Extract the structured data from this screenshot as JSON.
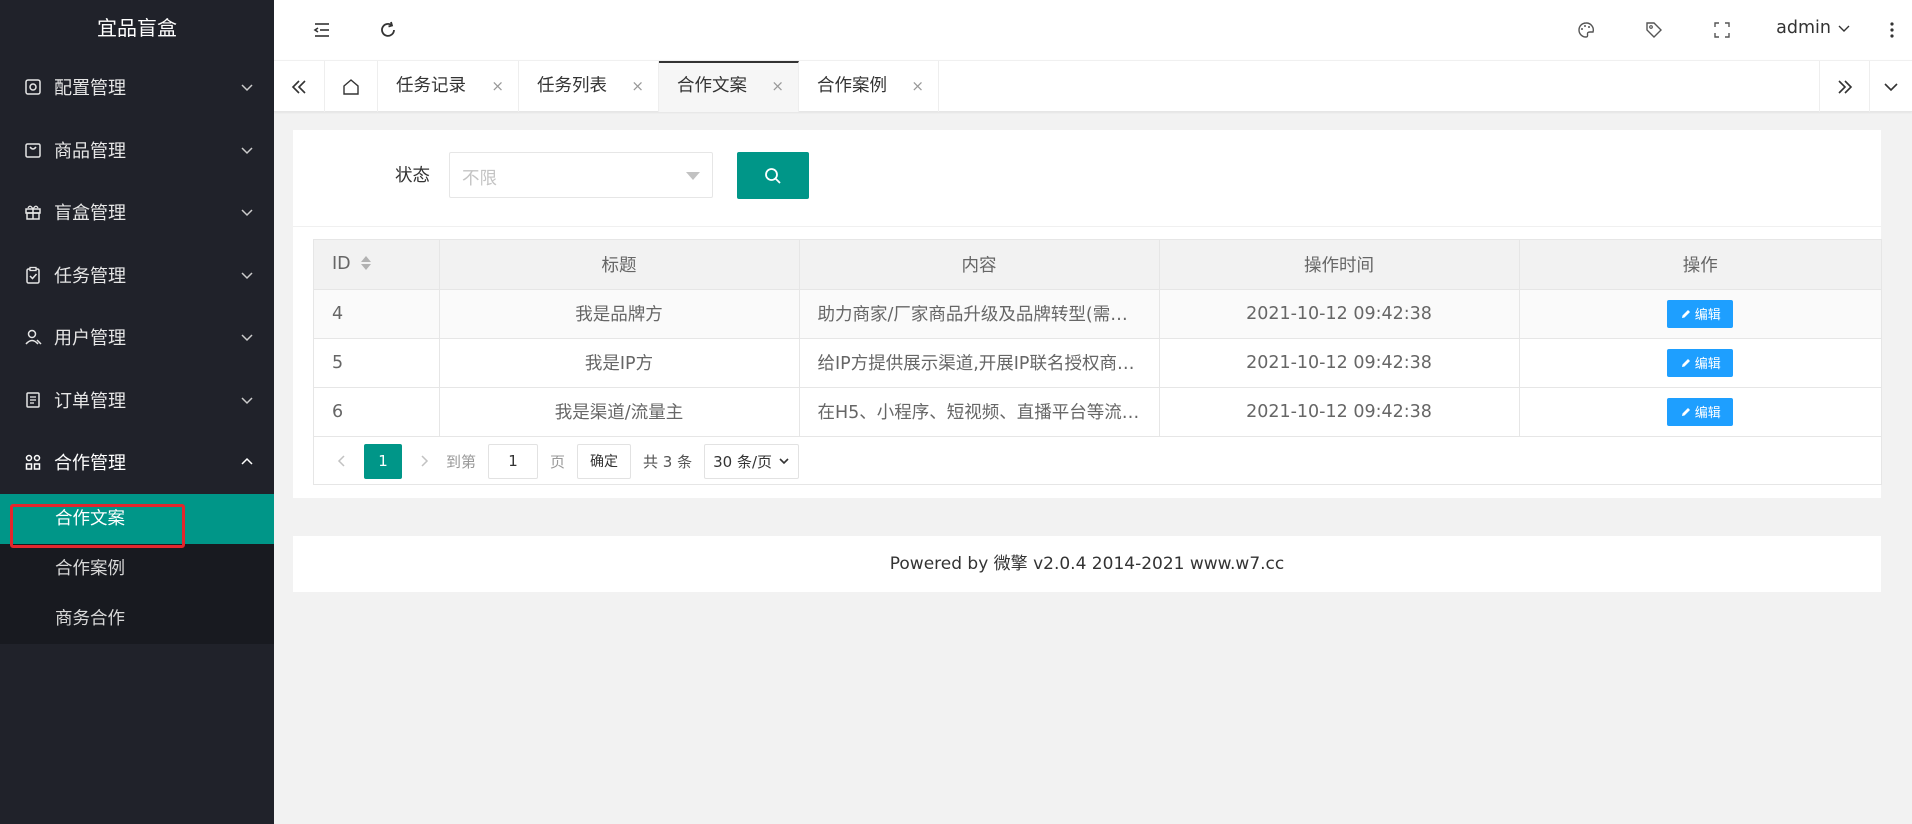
{
  "app": {
    "title": "宜品盲盒"
  },
  "sidebar": {
    "items": [
      {
        "label": "配置管理",
        "icon": "settings-icon"
      },
      {
        "label": "商品管理",
        "icon": "shopping-bag-icon"
      },
      {
        "label": "盲盒管理",
        "icon": "gift-icon"
      },
      {
        "label": "任务管理",
        "icon": "clipboard-check-icon"
      },
      {
        "label": "用户管理",
        "icon": "user-icon"
      },
      {
        "label": "订单管理",
        "icon": "document-icon"
      },
      {
        "label": "合作管理",
        "icon": "cooperation-icon"
      }
    ],
    "sub_items": [
      {
        "label": "合作文案",
        "active": true
      },
      {
        "label": "合作案例",
        "active": false
      },
      {
        "label": "商务合作",
        "active": false
      }
    ]
  },
  "header": {
    "user": "admin",
    "icons": [
      "menu-fold-icon",
      "refresh-icon",
      "theme-icon",
      "tag-icon",
      "fullscreen-icon",
      "more-vertical-icon"
    ]
  },
  "tabs": [
    {
      "label": "任务记录",
      "close": "×"
    },
    {
      "label": "任务列表",
      "close": "×"
    },
    {
      "label": "合作文案",
      "close": "×",
      "active": true
    },
    {
      "label": "合作案例",
      "close": "×"
    }
  ],
  "filter": {
    "status_label": "状态",
    "status_placeholder": "不限"
  },
  "table": {
    "headers": [
      "ID",
      "标题",
      "内容",
      "操作时间",
      "操作"
    ],
    "rows": [
      {
        "id": "4",
        "title": "我是品牌方",
        "content": "助力商家/厂家商品升级及品牌转型(需…",
        "time": "2021-10-12 09:42:38",
        "action": "编辑"
      },
      {
        "id": "5",
        "title": "我是IP方",
        "content": "给IP方提供展示渠道,开展IP联名授权商…",
        "time": "2021-10-12 09:42:38",
        "action": "编辑"
      },
      {
        "id": "6",
        "title": "我是渠道/流量主",
        "content": "在H5、小程序、短视频、直播平台等流…",
        "time": "2021-10-12 09:42:38",
        "action": "编辑"
      }
    ]
  },
  "pagination": {
    "current": "1",
    "goto_label": "到第",
    "goto_value": "1",
    "page_unit": "页",
    "confirm": "确定",
    "total": "共 3 条",
    "page_size": "30 条/页"
  },
  "footer": {
    "text": "Powered by 微擎 v2.0.4 2014-2021 www.w7.cc"
  },
  "colors": {
    "primary": "#009688",
    "sidebar_bg": "#20222a",
    "edit_button": "#1e9fff",
    "annotation": "#e3262d"
  }
}
